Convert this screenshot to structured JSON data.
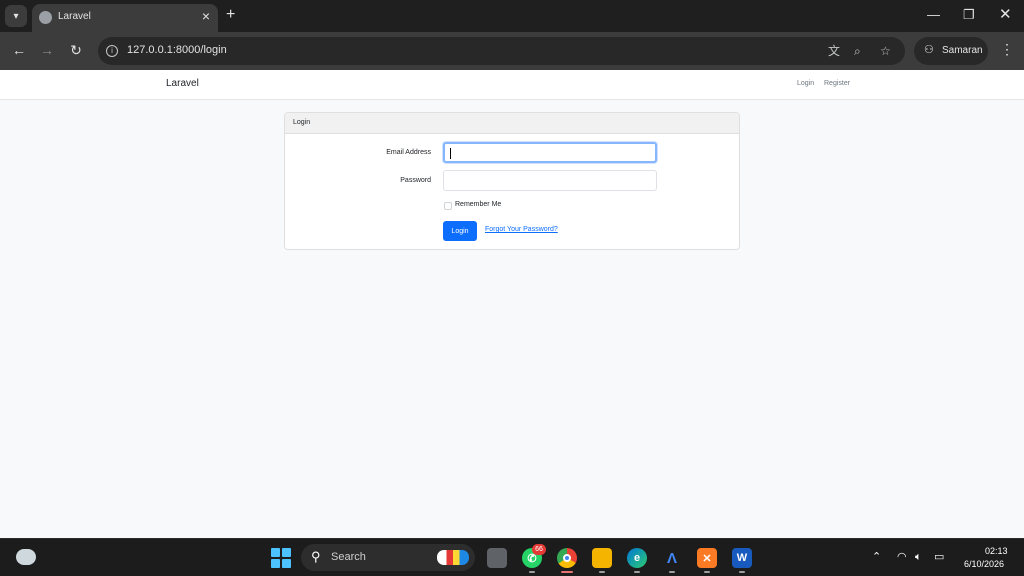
{
  "browser": {
    "tab_title": "Laravel",
    "url": "127.0.0.1:8000/login",
    "profile_name": "Samaran",
    "icons": {
      "tab_search": "chevron-down-icon",
      "tab_close": "close-icon",
      "new_tab": "plus-icon",
      "back": "back-arrow-icon",
      "forward": "forward-arrow-icon",
      "reload": "reload-icon",
      "site_info": "info-icon",
      "translate": "translate-icon",
      "zoom": "zoom-icon",
      "bookmark": "star-icon",
      "incognito": "incognito-icon",
      "menu": "kebab-menu-icon"
    }
  },
  "navbar": {
    "brand": "Laravel",
    "links": {
      "login": "Login",
      "register": "Register"
    }
  },
  "login_card": {
    "header": "Login",
    "email_label": "Email Address",
    "email_value": "",
    "password_label": "Password",
    "password_value": "",
    "remember_label": "Remember Me",
    "remember_checked": false,
    "submit_label": "Login",
    "forgot_link": "Forgot Your Password?"
  },
  "taskbar": {
    "search_label": "Search",
    "whatsapp_badge": "66",
    "time": "02:13",
    "date": "6/10/2026",
    "apps": [
      "start-icon",
      "task-view-icon",
      "whatsapp-icon",
      "chrome-icon",
      "file-explorer-icon",
      "edge-icon",
      "android-studio-icon",
      "xampp-icon",
      "word-icon"
    ]
  },
  "colors": {
    "primary": "#0d6efd",
    "focus_ring": "#86b7fe",
    "page_bg": "#f8f9fa",
    "browser_chrome": "#3c3c3c"
  }
}
